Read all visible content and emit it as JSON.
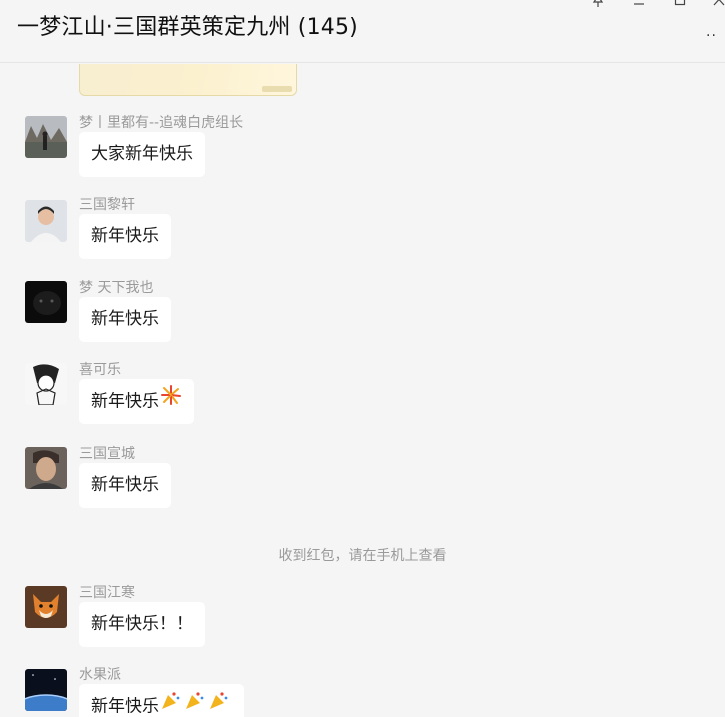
{
  "window": {
    "title": "一梦江山·三国群英策定九州 (145)",
    "controls": [
      "pin-icon",
      "minimize-icon",
      "maximize-icon",
      "close-icon",
      "more-icon"
    ],
    "more_glyph": "··"
  },
  "messages": [
    {
      "sender": "梦丨里都有--追魂白虎组长",
      "text": "大家新年快乐",
      "avatar": "avatar-outdoor-photo"
    },
    {
      "sender": "三国黎轩",
      "text": "新年快乐",
      "avatar": "avatar-man-portrait"
    },
    {
      "sender": "梦   天下我也",
      "text": "新年快乐",
      "avatar": "avatar-black-panther"
    },
    {
      "sender": "喜可乐",
      "text": "新年快乐",
      "emoji": "fireworks-emoji",
      "avatar": "avatar-anime-sketch"
    },
    {
      "sender": "三国宣城",
      "text": "新年快乐",
      "avatar": "avatar-cartoon-face"
    },
    {
      "sender": "三国江寒",
      "text": "新年快乐！！",
      "avatar": "avatar-fox-character"
    },
    {
      "sender": "水果派",
      "text": "新年快乐",
      "emoji": "party-popper-emoji",
      "avatar": "avatar-earth-orbit"
    }
  ],
  "system_note": "收到红包，请在手机上查看",
  "colors": {
    "background": "#f5f5f5",
    "bubble": "#ffffff",
    "sender_text": "#9a9a9a",
    "message_text": "#1a1a1a"
  }
}
